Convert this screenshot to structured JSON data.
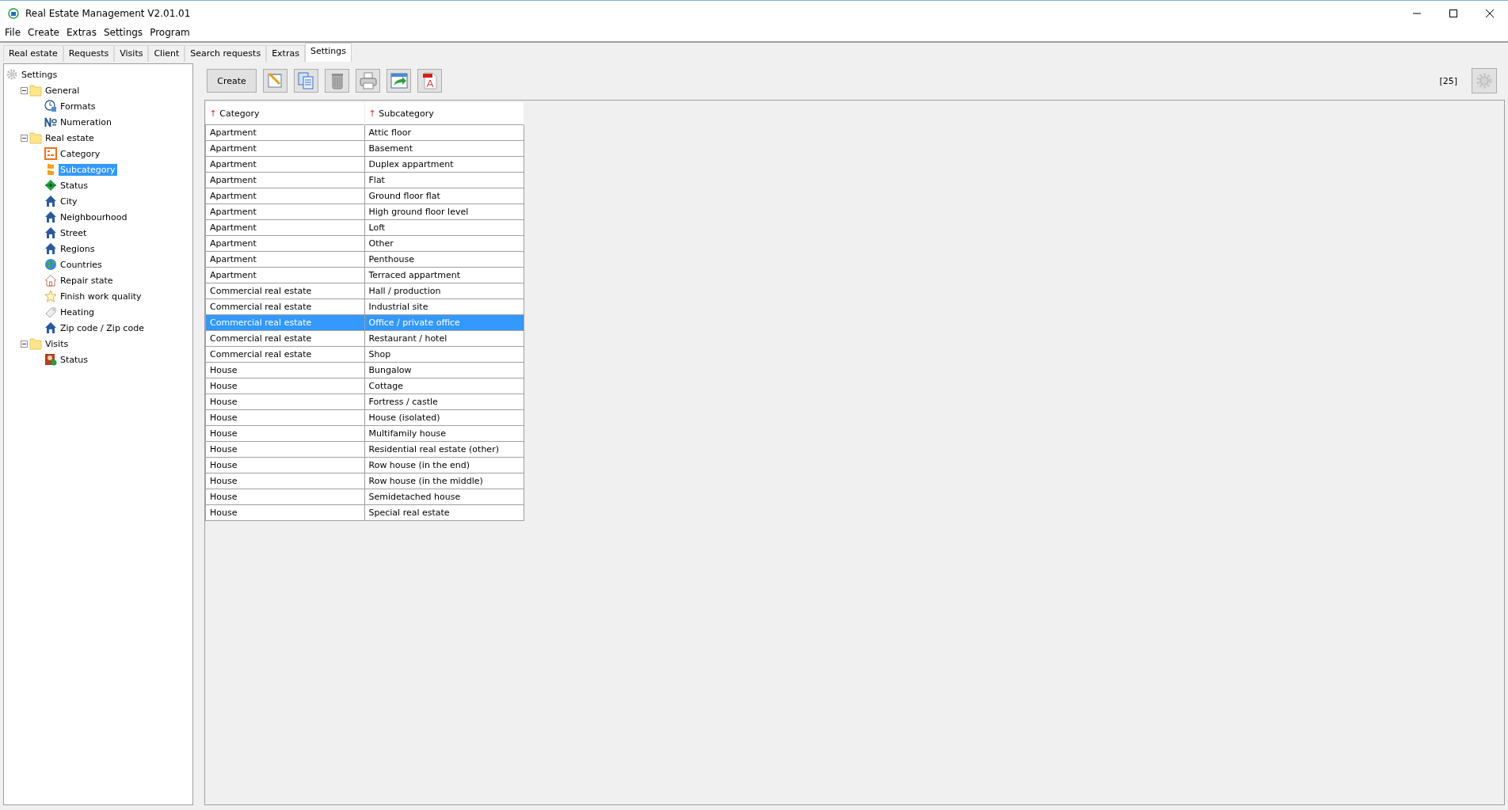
{
  "window": {
    "title": "Real Estate Management V2.01.01"
  },
  "menu": [
    "File",
    "Create",
    "Extras",
    "Settings",
    "Program"
  ],
  "tabs": [
    {
      "label": "Real estate",
      "selected": false
    },
    {
      "label": "Requests",
      "selected": false
    },
    {
      "label": "Visits",
      "selected": false
    },
    {
      "label": "Client",
      "selected": false
    },
    {
      "label": "Search requests",
      "selected": false
    },
    {
      "label": "Extras",
      "selected": false
    },
    {
      "label": "Settings",
      "selected": true
    }
  ],
  "tree": [
    {
      "label": "Settings",
      "kind": "gear",
      "selected": false,
      "children": [
        {
          "label": "General",
          "kind": "folder",
          "expanded": true,
          "selected": false,
          "children": [
            {
              "label": "Formats",
              "kind": "clock",
              "selected": false
            },
            {
              "label": "Numeration",
              "kind": "numero",
              "selected": false
            }
          ]
        },
        {
          "label": "Real estate",
          "kind": "folder",
          "expanded": true,
          "selected": false,
          "children": [
            {
              "label": "Category",
              "kind": "category",
              "selected": false
            },
            {
              "label": "Subcategory",
              "kind": "subcategory",
              "selected": true
            },
            {
              "label": "Status",
              "kind": "diamond",
              "selected": false
            },
            {
              "label": "City",
              "kind": "house",
              "selected": false
            },
            {
              "label": "Neighbourhood",
              "kind": "house",
              "selected": false
            },
            {
              "label": "Street",
              "kind": "house",
              "selected": false
            },
            {
              "label": "Regions",
              "kind": "house",
              "selected": false
            },
            {
              "label": "Countries",
              "kind": "globe",
              "selected": false
            },
            {
              "label": "Repair state",
              "kind": "house-outline",
              "selected": false
            },
            {
              "label": "Finish work quality",
              "kind": "star",
              "selected": false
            },
            {
              "label": "Heating",
              "kind": "tag",
              "selected": false
            },
            {
              "label": "Zip code / Zip code",
              "kind": "house",
              "selected": false
            }
          ]
        },
        {
          "label": "Visits",
          "kind": "folder",
          "expanded": true,
          "selected": false,
          "children": [
            {
              "label": "Status",
              "kind": "person",
              "selected": false
            }
          ]
        }
      ]
    }
  ],
  "toolbar": {
    "buttons": [
      {
        "kind": "text",
        "label": "Create"
      },
      {
        "kind": "edit"
      },
      {
        "kind": "copy"
      },
      {
        "kind": "delete"
      },
      {
        "kind": "print"
      },
      {
        "kind": "export"
      },
      {
        "kind": "pdf"
      }
    ],
    "count": "[25]"
  },
  "table": {
    "columns": [
      {
        "label": "Category",
        "sort_mark": "↑"
      },
      {
        "label": "Subcategory",
        "sort_mark": "↑"
      }
    ],
    "rows": [
      {
        "cells": [
          "Apartment",
          "Attic floor"
        ],
        "selected": false
      },
      {
        "cells": [
          "Apartment",
          "Basement"
        ],
        "selected": false
      },
      {
        "cells": [
          "Apartment",
          "Duplex appartment"
        ],
        "selected": false
      },
      {
        "cells": [
          "Apartment",
          "Flat"
        ],
        "selected": false
      },
      {
        "cells": [
          "Apartment",
          "Ground floor flat"
        ],
        "selected": false
      },
      {
        "cells": [
          "Apartment",
          "High ground floor level"
        ],
        "selected": false
      },
      {
        "cells": [
          "Apartment",
          "Loft"
        ],
        "selected": false
      },
      {
        "cells": [
          "Apartment",
          "Other"
        ],
        "selected": false
      },
      {
        "cells": [
          "Apartment",
          "Penthouse"
        ],
        "selected": false
      },
      {
        "cells": [
          "Apartment",
          "Terraced appartment"
        ],
        "selected": false
      },
      {
        "cells": [
          "Commercial real estate",
          "Hall / production"
        ],
        "selected": false
      },
      {
        "cells": [
          "Commercial real estate",
          "Industrial site"
        ],
        "selected": false
      },
      {
        "cells": [
          "Commercial real estate",
          "Office / private office"
        ],
        "selected": true
      },
      {
        "cells": [
          "Commercial real estate",
          "Restaurant / hotel"
        ],
        "selected": false
      },
      {
        "cells": [
          "Commercial real estate",
          "Shop"
        ],
        "selected": false
      },
      {
        "cells": [
          "House",
          "Bungalow"
        ],
        "selected": false
      },
      {
        "cells": [
          "House",
          "Cottage"
        ],
        "selected": false
      },
      {
        "cells": [
          "House",
          "Fortress / castle"
        ],
        "selected": false
      },
      {
        "cells": [
          "House",
          "House (isolated)"
        ],
        "selected": false
      },
      {
        "cells": [
          "House",
          "Multifamily house"
        ],
        "selected": false
      },
      {
        "cells": [
          "House",
          "Residential real estate (other)"
        ],
        "selected": false
      },
      {
        "cells": [
          "House",
          "Row house (in the end)"
        ],
        "selected": false
      },
      {
        "cells": [
          "House",
          "Row house (in the middle)"
        ],
        "selected": false
      },
      {
        "cells": [
          "House",
          "Semidetached house"
        ],
        "selected": false
      },
      {
        "cells": [
          "House",
          "Special real estate"
        ],
        "selected": false
      }
    ]
  }
}
